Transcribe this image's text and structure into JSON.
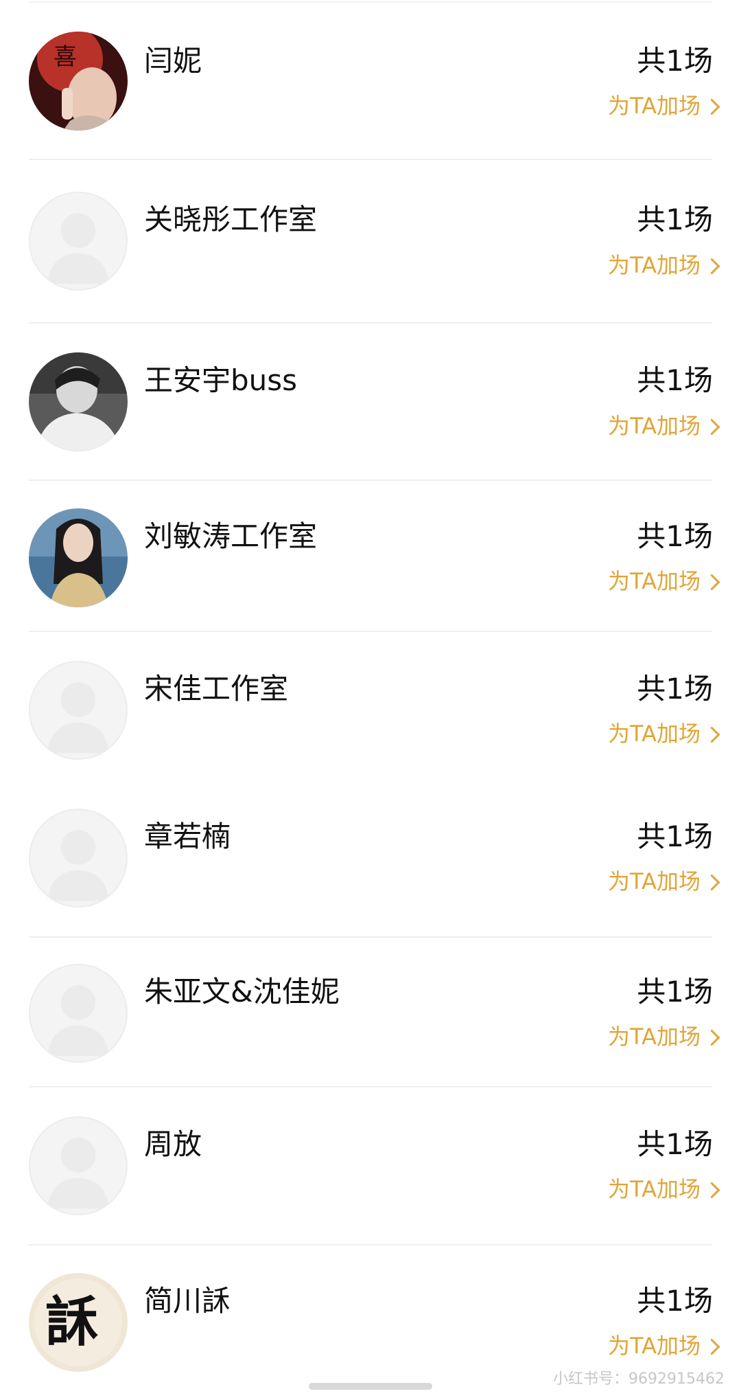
{
  "rows": [
    {
      "name": "闫妮",
      "count": "共1场",
      "boost": "为TA加场",
      "avatar": "photo-red"
    },
    {
      "name": "关晓彤工作室",
      "count": "共1场",
      "boost": "为TA加场",
      "avatar": "placeholder"
    },
    {
      "name": "王安宇buss",
      "count": "共1场",
      "boost": "为TA加场",
      "avatar": "photo-gray"
    },
    {
      "name": "刘敏涛工作室",
      "count": "共1场",
      "boost": "为TA加场",
      "avatar": "photo-blue"
    },
    {
      "name": "宋佳工作室",
      "count": "共1场",
      "boost": "为TA加场",
      "avatar": "placeholder"
    },
    {
      "name": "章若楠",
      "count": "共1场",
      "boost": "为TA加场",
      "avatar": "placeholder"
    },
    {
      "name": "朱亚文&沈佳妮",
      "count": "共1场",
      "boost": "为TA加场",
      "avatar": "placeholder"
    },
    {
      "name": "周放",
      "count": "共1场",
      "boost": "为TA加场",
      "avatar": "placeholder"
    },
    {
      "name": "简川訸",
      "count": "共1场",
      "boost": "为TA加场",
      "avatar": "photo-calligraphy"
    }
  ],
  "watermark": "小红书号：9692915462",
  "colors": {
    "accent": "#e0a536",
    "text": "#111111",
    "divider": "#eeeeee"
  }
}
